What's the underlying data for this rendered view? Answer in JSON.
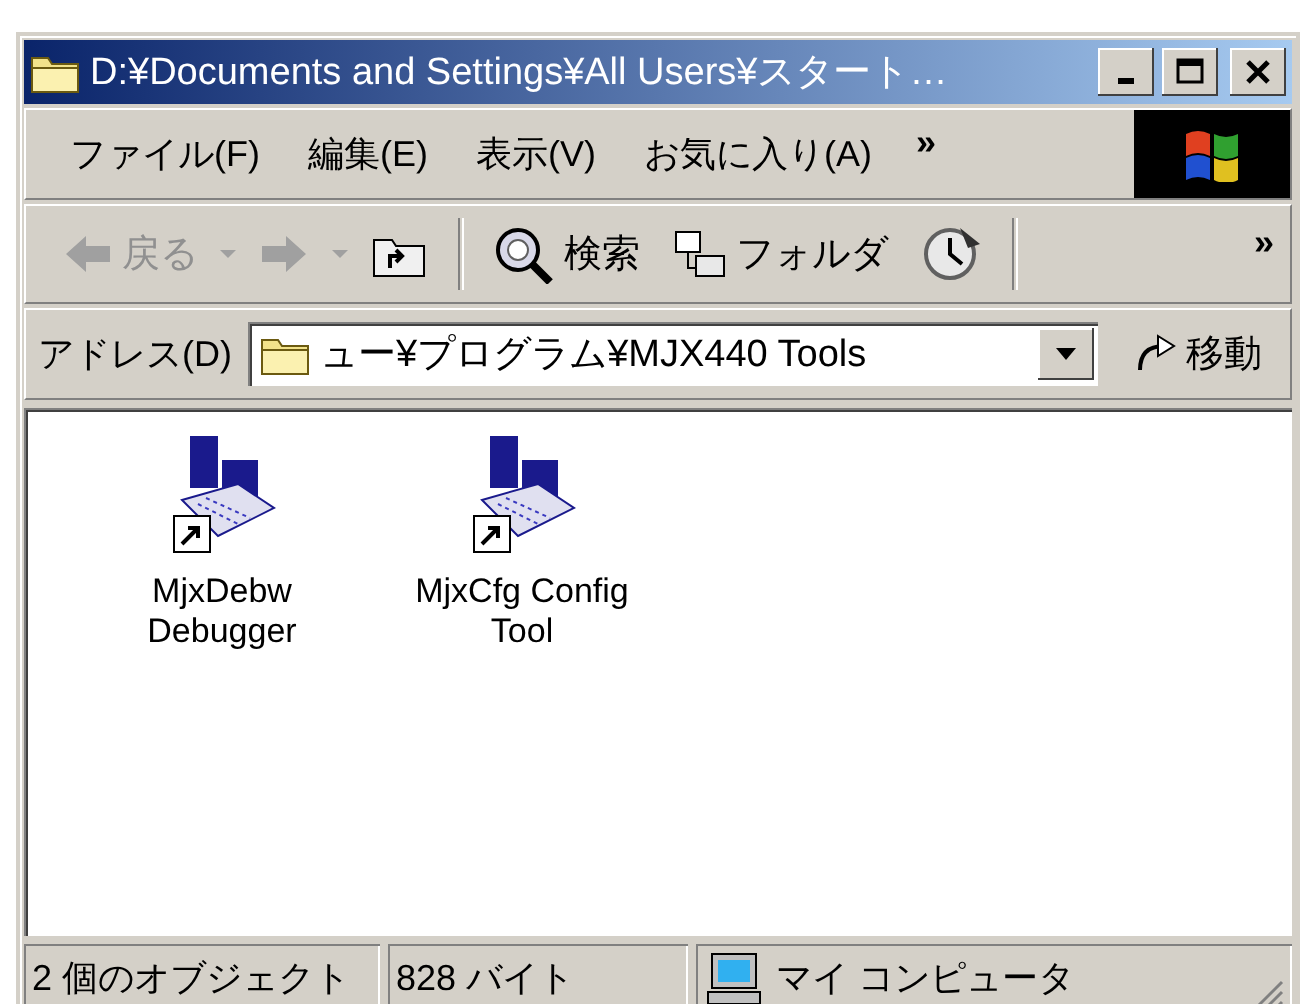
{
  "window": {
    "title": "D:¥Documents and Settings¥All Users¥スタート…"
  },
  "menu": [
    {
      "label": "ファイル(F)"
    },
    {
      "label": "編集(E)"
    },
    {
      "label": "表示(V)"
    },
    {
      "label": "お気に入り(A)"
    }
  ],
  "menu_overflow": "»",
  "toolbar": {
    "items": [
      {
        "kind": "back",
        "label": "戻る",
        "disabled": true
      },
      {
        "kind": "forward",
        "disabled": true
      },
      {
        "kind": "up",
        "disabled": false
      },
      {
        "kind": "search",
        "label": "検索",
        "disabled": false
      },
      {
        "kind": "folders",
        "label": "フォルダ",
        "disabled": false
      },
      {
        "kind": "history",
        "disabled": false
      }
    ],
    "overflow": "»"
  },
  "address": {
    "label": "アドレス(D)",
    "value": "ュー¥プログラム¥MJX440 Tools",
    "go": "移動"
  },
  "files": [
    {
      "name": "MjxDebw Debugger"
    },
    {
      "name": "MjxCfg Config Tool"
    }
  ],
  "status_bar": {
    "objects": "2 個のオブジェクト",
    "size": "828 バイト",
    "zone": "マイ コンピュータ"
  }
}
